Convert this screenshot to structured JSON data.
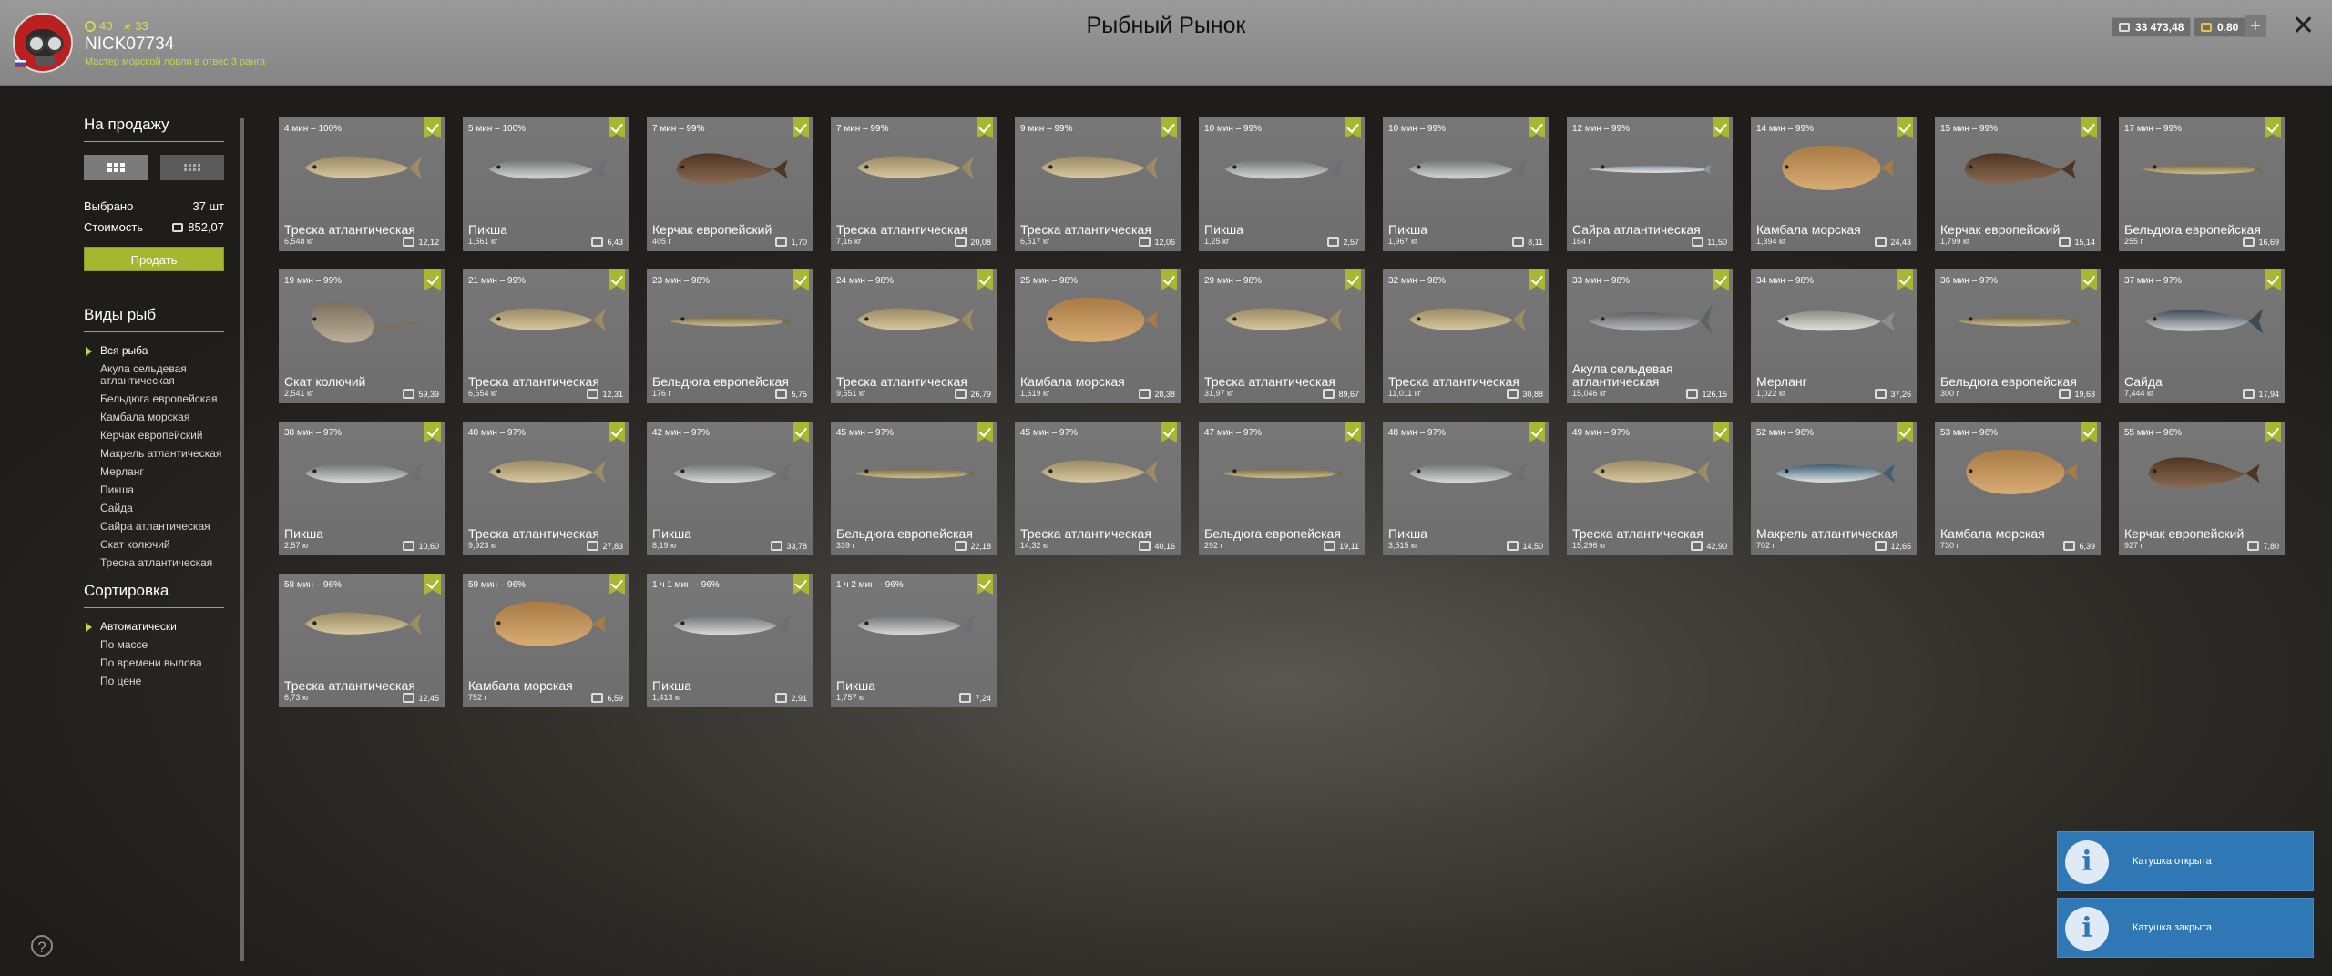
{
  "header": {
    "title": "Рыбный Рынок",
    "level": "40",
    "stars": "33",
    "nickname": "NICK07734",
    "rank": "Мастер морской ловли в отвес 3 ранга",
    "silver": "33 473,48",
    "gold": "0,80",
    "add_label": "+",
    "close_label": "✕"
  },
  "sidebar": {
    "sale_title": "На продажу",
    "selected_label": "Выбрано",
    "selected_value": "37 шт",
    "cost_label": "Стоимость",
    "cost_value": "852,07",
    "sell_label": "Продать",
    "species_title": "Виды рыб",
    "species": [
      "Вся рыба",
      "Акула сельдевая атлантическая",
      "Бельдюга европейская",
      "Камбала морская",
      "Керчак европейский",
      "Макрель атлантическая",
      "Мерланг",
      "Пикша",
      "Сайда",
      "Сайра атлантическая",
      "Скат колючий",
      "Треска атлантическая"
    ],
    "sort_title": "Сортировка",
    "sorts": [
      "Автоматически",
      "По массе",
      "По времени вылова",
      "По цене"
    ]
  },
  "cards": [
    {
      "time": "4 мин – 100%",
      "name": "Треска атлантическая",
      "weight": "6,548 кг",
      "price": "12,12",
      "kind": "cod"
    },
    {
      "time": "5 мин – 100%",
      "name": "Пикша",
      "weight": "1,561 кг",
      "price": "6,43",
      "kind": "haddock"
    },
    {
      "time": "7 мин – 99%",
      "name": "Керчак европейский",
      "weight": "405 г",
      "price": "1,70",
      "kind": "sculpin"
    },
    {
      "time": "7 мин – 99%",
      "name": "Треска атлантическая",
      "weight": "7,16 кг",
      "price": "20,08",
      "kind": "cod"
    },
    {
      "time": "9 мин – 99%",
      "name": "Треска атлантическая",
      "weight": "6,517 кг",
      "price": "12,06",
      "kind": "cod"
    },
    {
      "time": "10 мин – 99%",
      "name": "Пикша",
      "weight": "1,25 кг",
      "price": "2,57",
      "kind": "haddock"
    },
    {
      "time": "10 мин – 99%",
      "name": "Пикша",
      "weight": "1,967 кг",
      "price": "8,11",
      "kind": "haddock"
    },
    {
      "time": "12 мин – 99%",
      "name": "Сайра атлантическая",
      "weight": "164 г",
      "price": "11,50",
      "kind": "saury"
    },
    {
      "time": "14 мин – 99%",
      "name": "Камбала морская",
      "weight": "1,394 кг",
      "price": "24,43",
      "kind": "flounder"
    },
    {
      "time": "15 мин – 99%",
      "name": "Керчак европейский",
      "weight": "1,799 кг",
      "price": "15,14",
      "kind": "sculpin"
    },
    {
      "time": "17 мин – 99%",
      "name": "Бельдюга европейская",
      "weight": "255 г",
      "price": "16,69",
      "kind": "eelpout"
    },
    {
      "time": "19 мин – 99%",
      "name": "Скат колючий",
      "weight": "2,541 кг",
      "price": "59,39",
      "kind": "skate"
    },
    {
      "time": "21 мин – 99%",
      "name": "Треска атлантическая",
      "weight": "6,654 кг",
      "price": "12,31",
      "kind": "cod"
    },
    {
      "time": "23 мин – 98%",
      "name": "Бельдюга европейская",
      "weight": "176 г",
      "price": "5,75",
      "kind": "eelpout"
    },
    {
      "time": "24 мин – 98%",
      "name": "Треска атлантическая",
      "weight": "9,551 кг",
      "price": "26,79",
      "kind": "cod"
    },
    {
      "time": "25 мин – 98%",
      "name": "Камбала морская",
      "weight": "1,619 кг",
      "price": "28,38",
      "kind": "flounder"
    },
    {
      "time": "29 мин – 98%",
      "name": "Треска атлантическая",
      "weight": "31,97 кг",
      "price": "89,67",
      "kind": "cod"
    },
    {
      "time": "32 мин – 98%",
      "name": "Треска атлантическая",
      "weight": "11,011 кг",
      "price": "30,88",
      "kind": "cod"
    },
    {
      "time": "33 мин – 98%",
      "name": "Акула сельдевая атлантическая",
      "weight": "15,046 кг",
      "price": "126,15",
      "kind": "shark"
    },
    {
      "time": "34 мин – 98%",
      "name": "Мерланг",
      "weight": "1,022 кг",
      "price": "37,26",
      "kind": "whiting"
    },
    {
      "time": "36 мин – 97%",
      "name": "Бельдюга европейская",
      "weight": "300 г",
      "price": "19,63",
      "kind": "eelpout"
    },
    {
      "time": "37 мин – 97%",
      "name": "Сайда",
      "weight": "7,444 кг",
      "price": "17,94",
      "kind": "saithe"
    },
    {
      "time": "38 мин – 97%",
      "name": "Пикша",
      "weight": "2,57 кг",
      "price": "10,60",
      "kind": "haddock"
    },
    {
      "time": "40 мин – 97%",
      "name": "Треска атлантическая",
      "weight": "9,923 кг",
      "price": "27,83",
      "kind": "cod"
    },
    {
      "time": "42 мин – 97%",
      "name": "Пикша",
      "weight": "8,19 кг",
      "price": "33,78",
      "kind": "haddock"
    },
    {
      "time": "45 мин – 97%",
      "name": "Бельдюга европейская",
      "weight": "339 г",
      "price": "22,18",
      "kind": "eelpout"
    },
    {
      "time": "45 мин – 97%",
      "name": "Треска атлантическая",
      "weight": "14,32 кг",
      "price": "40,16",
      "kind": "cod"
    },
    {
      "time": "47 мин – 97%",
      "name": "Бельдюга европейская",
      "weight": "292 г",
      "price": "19,11",
      "kind": "eelpout"
    },
    {
      "time": "48 мин – 97%",
      "name": "Пикша",
      "weight": "3,515 кг",
      "price": "14,50",
      "kind": "haddock"
    },
    {
      "time": "49 мин – 97%",
      "name": "Треска атлантическая",
      "weight": "15,296 кг",
      "price": "42,90",
      "kind": "cod"
    },
    {
      "time": "52 мин – 96%",
      "name": "Макрель атлантическая",
      "weight": "702 г",
      "price": "12,65",
      "kind": "mackerel"
    },
    {
      "time": "53 мин – 96%",
      "name": "Камбала морская",
      "weight": "730 г",
      "price": "6,39",
      "kind": "flounder"
    },
    {
      "time": "55 мин – 96%",
      "name": "Керчак европейский",
      "weight": "927 г",
      "price": "7,80",
      "kind": "sculpin"
    },
    {
      "time": "58 мин – 96%",
      "name": "Треска атлантическая",
      "weight": "6,73 кг",
      "price": "12,45",
      "kind": "cod"
    },
    {
      "time": "59 мин – 96%",
      "name": "Камбала морская",
      "weight": "752 г",
      "price": "6,59",
      "kind": "flounder"
    },
    {
      "time": "1 ч 1 мин – 96%",
      "name": "Пикша",
      "weight": "1,413 кг",
      "price": "2,91",
      "kind": "haddock"
    },
    {
      "time": "1 ч 2 мин – 96%",
      "name": "Пикша",
      "weight": "1,757 кг",
      "price": "7,24",
      "kind": "haddock"
    }
  ],
  "toasts": [
    "Катушка открыта",
    "Катушка закрыта"
  ],
  "help_label": "?"
}
